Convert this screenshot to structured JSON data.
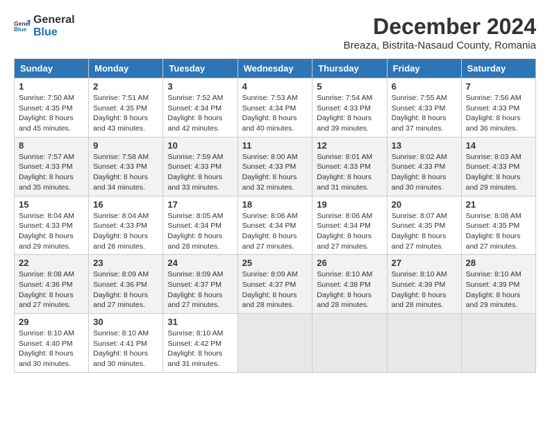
{
  "header": {
    "logo_general": "General",
    "logo_blue": "Blue",
    "month_year": "December 2024",
    "location": "Breaza, Bistrita-Nasaud County, Romania"
  },
  "days_of_week": [
    "Sunday",
    "Monday",
    "Tuesday",
    "Wednesday",
    "Thursday",
    "Friday",
    "Saturday"
  ],
  "weeks": [
    [
      {
        "day": "1",
        "sunrise": "7:50 AM",
        "sunset": "4:35 PM",
        "daylight": "8 hours and 45 minutes."
      },
      {
        "day": "2",
        "sunrise": "7:51 AM",
        "sunset": "4:35 PM",
        "daylight": "8 hours and 43 minutes."
      },
      {
        "day": "3",
        "sunrise": "7:52 AM",
        "sunset": "4:34 PM",
        "daylight": "8 hours and 42 minutes."
      },
      {
        "day": "4",
        "sunrise": "7:53 AM",
        "sunset": "4:34 PM",
        "daylight": "8 hours and 40 minutes."
      },
      {
        "day": "5",
        "sunrise": "7:54 AM",
        "sunset": "4:33 PM",
        "daylight": "8 hours and 39 minutes."
      },
      {
        "day": "6",
        "sunrise": "7:55 AM",
        "sunset": "4:33 PM",
        "daylight": "8 hours and 37 minutes."
      },
      {
        "day": "7",
        "sunrise": "7:56 AM",
        "sunset": "4:33 PM",
        "daylight": "8 hours and 36 minutes."
      }
    ],
    [
      {
        "day": "8",
        "sunrise": "7:57 AM",
        "sunset": "4:33 PM",
        "daylight": "8 hours and 35 minutes."
      },
      {
        "day": "9",
        "sunrise": "7:58 AM",
        "sunset": "4:33 PM",
        "daylight": "8 hours and 34 minutes."
      },
      {
        "day": "10",
        "sunrise": "7:59 AM",
        "sunset": "4:33 PM",
        "daylight": "8 hours and 33 minutes."
      },
      {
        "day": "11",
        "sunrise": "8:00 AM",
        "sunset": "4:33 PM",
        "daylight": "8 hours and 32 minutes."
      },
      {
        "day": "12",
        "sunrise": "8:01 AM",
        "sunset": "4:33 PM",
        "daylight": "8 hours and 31 minutes."
      },
      {
        "day": "13",
        "sunrise": "8:02 AM",
        "sunset": "4:33 PM",
        "daylight": "8 hours and 30 minutes."
      },
      {
        "day": "14",
        "sunrise": "8:03 AM",
        "sunset": "4:33 PM",
        "daylight": "8 hours and 29 minutes."
      }
    ],
    [
      {
        "day": "15",
        "sunrise": "8:04 AM",
        "sunset": "4:33 PM",
        "daylight": "8 hours and 29 minutes."
      },
      {
        "day": "16",
        "sunrise": "8:04 AM",
        "sunset": "4:33 PM",
        "daylight": "8 hours and 28 minutes."
      },
      {
        "day": "17",
        "sunrise": "8:05 AM",
        "sunset": "4:34 PM",
        "daylight": "8 hours and 28 minutes."
      },
      {
        "day": "18",
        "sunrise": "8:06 AM",
        "sunset": "4:34 PM",
        "daylight": "8 hours and 27 minutes."
      },
      {
        "day": "19",
        "sunrise": "8:06 AM",
        "sunset": "4:34 PM",
        "daylight": "8 hours and 27 minutes."
      },
      {
        "day": "20",
        "sunrise": "8:07 AM",
        "sunset": "4:35 PM",
        "daylight": "8 hours and 27 minutes."
      },
      {
        "day": "21",
        "sunrise": "8:08 AM",
        "sunset": "4:35 PM",
        "daylight": "8 hours and 27 minutes."
      }
    ],
    [
      {
        "day": "22",
        "sunrise": "8:08 AM",
        "sunset": "4:36 PM",
        "daylight": "8 hours and 27 minutes."
      },
      {
        "day": "23",
        "sunrise": "8:09 AM",
        "sunset": "4:36 PM",
        "daylight": "8 hours and 27 minutes."
      },
      {
        "day": "24",
        "sunrise": "8:09 AM",
        "sunset": "4:37 PM",
        "daylight": "8 hours and 27 minutes."
      },
      {
        "day": "25",
        "sunrise": "8:09 AM",
        "sunset": "4:37 PM",
        "daylight": "8 hours and 28 minutes."
      },
      {
        "day": "26",
        "sunrise": "8:10 AM",
        "sunset": "4:38 PM",
        "daylight": "8 hours and 28 minutes."
      },
      {
        "day": "27",
        "sunrise": "8:10 AM",
        "sunset": "4:39 PM",
        "daylight": "8 hours and 28 minutes."
      },
      {
        "day": "28",
        "sunrise": "8:10 AM",
        "sunset": "4:39 PM",
        "daylight": "8 hours and 29 minutes."
      }
    ],
    [
      {
        "day": "29",
        "sunrise": "8:10 AM",
        "sunset": "4:40 PM",
        "daylight": "8 hours and 30 minutes."
      },
      {
        "day": "30",
        "sunrise": "8:10 AM",
        "sunset": "4:41 PM",
        "daylight": "8 hours and 30 minutes."
      },
      {
        "day": "31",
        "sunrise": "8:10 AM",
        "sunset": "4:42 PM",
        "daylight": "8 hours and 31 minutes."
      },
      null,
      null,
      null,
      null
    ]
  ]
}
